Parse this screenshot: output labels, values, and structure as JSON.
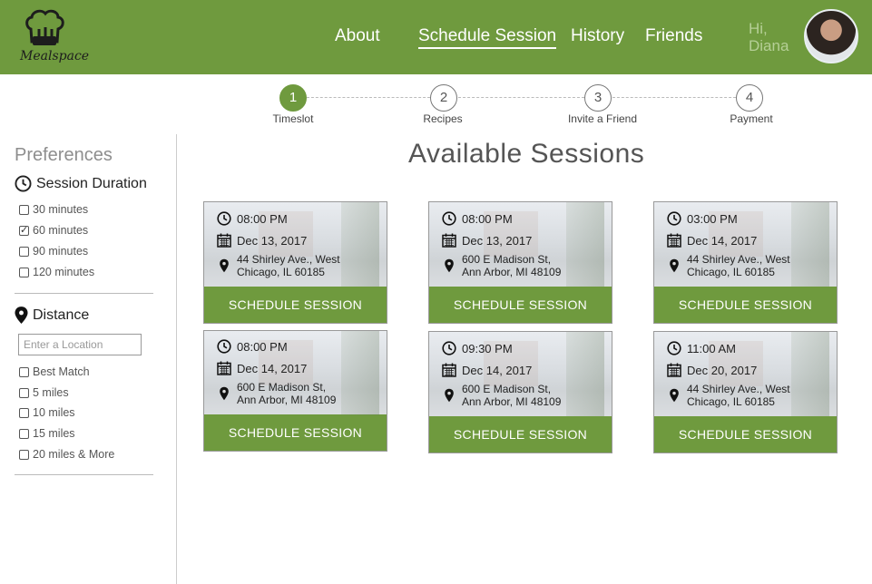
{
  "header": {
    "logo_text": "Mealspace",
    "nav": [
      {
        "label": "About"
      },
      {
        "label": "Schedule Session"
      },
      {
        "label": "History"
      },
      {
        "label": "Friends"
      }
    ],
    "greeting_hi": "Hi,",
    "greeting_name": "Diana",
    "accent_color": "#6f9a3e"
  },
  "stepper": {
    "steps": [
      {
        "number": "1",
        "label": "Timeslot",
        "active": true
      },
      {
        "number": "2",
        "label": "Recipes",
        "active": false
      },
      {
        "number": "3",
        "label": "Invite a Friend",
        "active": false
      },
      {
        "number": "4",
        "label": "Payment",
        "active": false
      }
    ]
  },
  "sidebar": {
    "title": "Preferences",
    "duration": {
      "heading": "Session Duration",
      "options": [
        {
          "label": "30 minutes",
          "checked": false
        },
        {
          "label": "60 minutes",
          "checked": true
        },
        {
          "label": "90 minutes",
          "checked": false
        },
        {
          "label": "120 minutes",
          "checked": false
        }
      ]
    },
    "distance": {
      "heading": "Distance",
      "location_placeholder": "Enter a Location",
      "options": [
        {
          "label": "Best Match",
          "checked": false
        },
        {
          "label": "5 miles",
          "checked": false
        },
        {
          "label": "10 miles",
          "checked": false
        },
        {
          "label": "15 miles",
          "checked": false
        },
        {
          "label": "20 miles & More",
          "checked": false
        }
      ]
    }
  },
  "main": {
    "title": "Available Sessions",
    "button_label": "SCHEDULE SESSION",
    "sessions": [
      {
        "time": "08:00 PM",
        "date": "Dec 13, 2017",
        "address_line1": "44 Shirley Ave., West",
        "address_line2": "Chicago, IL 60185"
      },
      {
        "time": "08:00 PM",
        "date": "Dec 13, 2017",
        "address_line1": "600 E Madison St,",
        "address_line2": "Ann Arbor, MI 48109"
      },
      {
        "time": "03:00 PM",
        "date": "Dec 14, 2017",
        "address_line1": "44 Shirley Ave., West",
        "address_line2": "Chicago, IL 60185"
      },
      {
        "time": "08:00 PM",
        "date": "Dec 14, 2017",
        "address_line1": "600 E Madison St,",
        "address_line2": "Ann Arbor, MI 48109"
      },
      {
        "time": "09:30 PM",
        "date": "Dec 14, 2017",
        "address_line1": "600 E Madison St,",
        "address_line2": "Ann Arbor, MI 48109"
      },
      {
        "time": "11:00 AM",
        "date": "Dec 20, 2017",
        "address_line1": "44 Shirley Ave., West",
        "address_line2": "Chicago, IL 60185"
      }
    ]
  }
}
